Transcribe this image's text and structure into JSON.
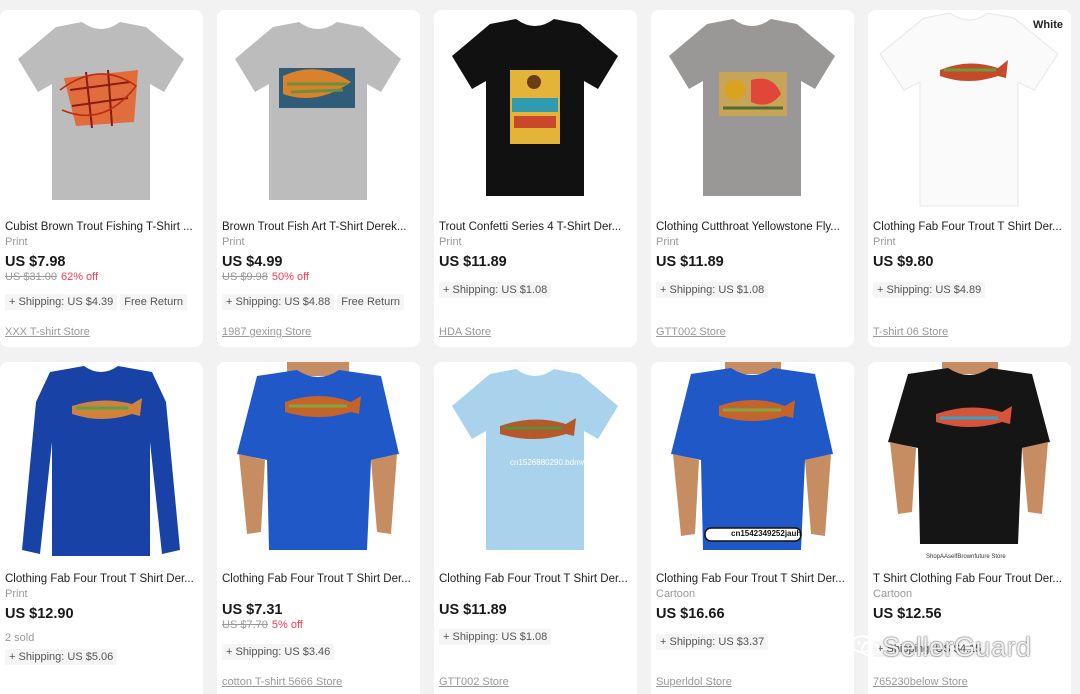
{
  "products": [
    {
      "title": "Cubist Brown Trout Fishing T-Shirt ...",
      "sub": "Print",
      "price": "US $7.98",
      "orig": "US $31.00",
      "discount": "62% off",
      "sold": "",
      "tags": [
        "+ Shipping: US $4.39",
        "Free Return"
      ],
      "store": "XXX T-shirt Store"
    },
    {
      "title": "Brown Trout Fish Art T-Shirt Derek...",
      "sub": "Print",
      "price": "US $4.99",
      "orig": "US $9.98",
      "discount": "50% off",
      "sold": "",
      "tags": [
        "+ Shipping: US $4.88",
        "Free Return"
      ],
      "store": "1987 gexing Store"
    },
    {
      "title": "Trout Confetti Series 4 T-Shirt Der...",
      "sub": "Print",
      "price": "US $11.89",
      "orig": "",
      "discount": "",
      "sold": "",
      "tags": [
        "+ Shipping: US $1.08"
      ],
      "store": "HDA Store"
    },
    {
      "title": "Clothing Cutthroat Yellowstone Fly...",
      "sub": "Print",
      "price": "US $11.89",
      "orig": "",
      "discount": "",
      "sold": "",
      "tags": [
        "+ Shipping: US $1.08"
      ],
      "store": "GTT002 Store"
    },
    {
      "title": "Clothing Fab Four Trout T Shirt Der...",
      "sub": "Print",
      "price": "US $9.80",
      "orig": "",
      "discount": "",
      "sold": "",
      "tags": [
        "+ Shipping: US $4.89"
      ],
      "store": "T-shirt 06 Store"
    },
    {
      "title": "Clothing Fab Four Trout T Shirt Der...",
      "sub": "Print",
      "price": "US $12.90",
      "orig": "",
      "discount": "",
      "sold": "2 sold",
      "tags": [
        "+ Shipping: US $5.06"
      ],
      "store": ""
    },
    {
      "title": "Clothing Fab Four Trout T Shirt Der...",
      "sub": "",
      "price": "US $7.31",
      "orig": "US $7.70",
      "discount": "5% off",
      "sold": "",
      "tags": [
        "+ Shipping: US $3.46"
      ],
      "store": "cotton T-shirt 5666 Store"
    },
    {
      "title": "Clothing Fab Four Trout T Shirt Der...",
      "sub": "",
      "price": "US $11.89",
      "orig": "",
      "discount": "",
      "sold": "",
      "tags": [
        "+ Shipping: US $1.08"
      ],
      "store": "GTT002 Store"
    },
    {
      "title": "Clothing Fab Four Trout T Shirt Der...",
      "sub": "Cartoon",
      "price": "US $16.66",
      "orig": "",
      "discount": "",
      "sold": "",
      "tags": [
        "+ Shipping: US $3.37"
      ],
      "store": "Superldol Store"
    },
    {
      "title": "T Shirt Clothing Fab Four Trout Der...",
      "sub": "Cartoon",
      "price": "US $12.56",
      "orig": "",
      "discount": "",
      "sold": "",
      "tags": [
        "+ Shipping: US $4.15"
      ],
      "store": "765230below Store"
    }
  ],
  "color_label": "White",
  "image_captions": {
    "p8": "cn1526880290.bdmw",
    "p9": "cn1542349252jauh",
    "p10": "ShopAAselfBrownfuture Store"
  },
  "watermark": "SellerGuard",
  "colors": {
    "discount": "#fd384f",
    "background": "#f2f2f2"
  }
}
